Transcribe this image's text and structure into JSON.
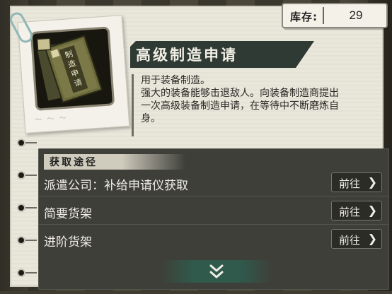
{
  "stock": {
    "label": "库存:",
    "value": "29"
  },
  "item": {
    "title": "高级制造申请",
    "icon_name": "manufacturing-request-book-icon",
    "description_lines": [
      "用于装备制造。",
      "强大的装备能够击退敌人。向装备制造商提出",
      "一次高级装备制造申请，在等待中不断磨炼自",
      "身。"
    ]
  },
  "acquisition": {
    "header": "获取途径",
    "routes": [
      {
        "label": "派遣公司：补给申请仪获取",
        "button": "前往"
      },
      {
        "label": "简要货架",
        "button": "前往"
      },
      {
        "label": "进阶货架",
        "button": "前往"
      }
    ]
  },
  "colors": {
    "title_banner": "#2e3a33",
    "panel": "#3f3f39",
    "paper": "#e9e6da",
    "expand_accent": "#2f5a4c"
  }
}
